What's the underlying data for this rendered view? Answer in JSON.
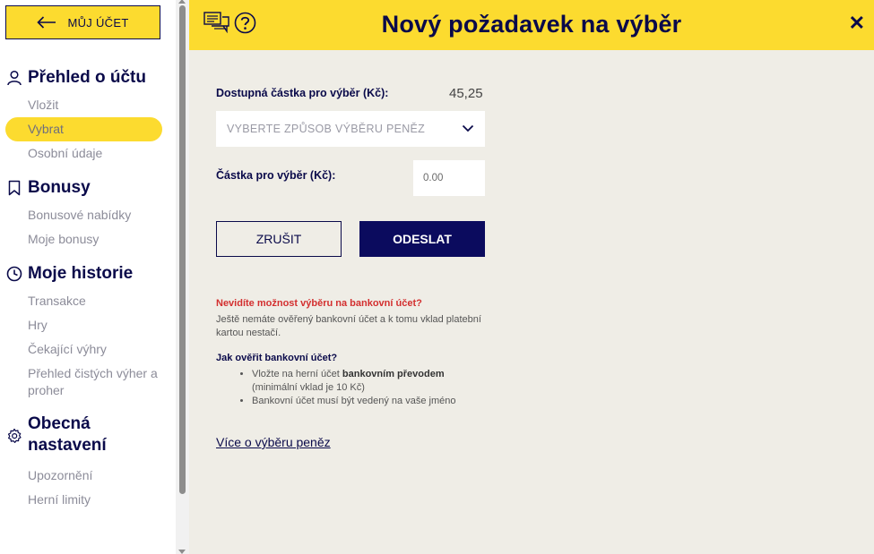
{
  "sidebar": {
    "account_button": "MŮJ ÚČET",
    "sections": {
      "overview": {
        "title": "Přehled o účtu",
        "items": [
          "Vložit",
          "Vybrat",
          "Osobní údaje"
        ]
      },
      "bonuses": {
        "title": "Bonusy",
        "items": [
          "Bonusové nabídky",
          "Moje bonusy"
        ]
      },
      "history": {
        "title": "Moje historie",
        "items": [
          "Transakce",
          "Hry",
          "Čekající výhry",
          "Přehled čistých výher a proher"
        ]
      },
      "settings": {
        "title_line1": "Obecná",
        "title_line2": "nastavení",
        "items": [
          "Upozornění",
          "Herní limity"
        ]
      }
    },
    "active_item": "Vybrat"
  },
  "header": {
    "title": "Nový požadavek na výběr",
    "close_symbol": "✕"
  },
  "form": {
    "available_label": "Dostupná částka pro výběr (Kč):",
    "available_value": "45,25",
    "method_placeholder": "VYBERTE ZPŮSOB VÝBĚRU PENĚZ",
    "amount_label": "Částka pro výběr (Kč):",
    "amount_placeholder": "0.00",
    "cancel_label": "ZRUŠIT",
    "submit_label": "ODESLAT"
  },
  "info": {
    "warning_title": "Nevidíte možnost výběru na bankovní účet?",
    "warning_text": "Ještě nemáte ověřený bankovní účet a k tomu vklad platební kartou nestačí.",
    "verify_title": "Jak ověřit bankovní účet?",
    "bullet1_pre": "Vložte na herní účet ",
    "bullet1_bold": "bankovním převodem",
    "bullet1_post": " (minimální vklad je 10 Kč)",
    "bullet2": "Bankovní účet musí být vedený na vaše jméno",
    "more_link": "Více o výběru peněz"
  },
  "colors": {
    "brand_yellow": "#fcdb2f",
    "navy": "#0a0a4a",
    "warning_red": "#d32f2f",
    "background": "#efede6"
  }
}
